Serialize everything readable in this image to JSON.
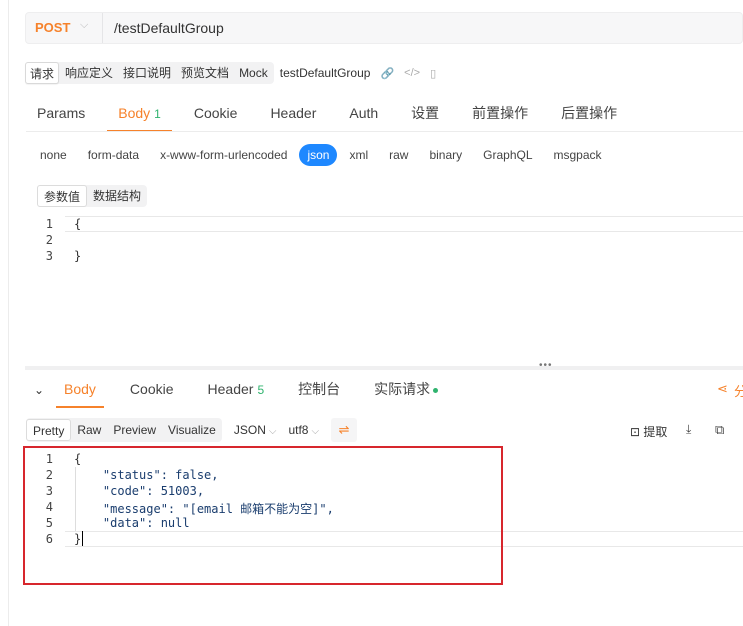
{
  "request": {
    "method": "POST",
    "url": "/testDefaultGroup"
  },
  "subtabs": {
    "items": [
      "请求",
      "响应定义",
      "接口说明",
      "预览文档",
      "Mock"
    ],
    "active": "请求",
    "doc_name": "testDefaultGroup"
  },
  "request_tabs": [
    {
      "label": "Params"
    },
    {
      "label": "Body",
      "count": "1"
    },
    {
      "label": "Cookie"
    },
    {
      "label": "Header"
    },
    {
      "label": "Auth"
    },
    {
      "label": "设置"
    },
    {
      "label": "前置操作"
    },
    {
      "label": "后置操作"
    }
  ],
  "body_types": [
    "none",
    "form-data",
    "x-www-form-urlencoded",
    "json",
    "xml",
    "raw",
    "binary",
    "GraphQL",
    "msgpack"
  ],
  "body_type_active": "json",
  "param_tabs": [
    "参数值",
    "数据结构"
  ],
  "request_editor": {
    "line_numbers": [
      "1",
      "2",
      "3"
    ],
    "lines": [
      "{",
      "",
      "}"
    ]
  },
  "response_tabs": [
    {
      "label": "Body"
    },
    {
      "label": "Cookie"
    },
    {
      "label": "Header",
      "count": "5"
    },
    {
      "label": "控制台"
    },
    {
      "label": "实际请求"
    }
  ],
  "share_label": "分",
  "viewer": {
    "modes": [
      "Pretty",
      "Raw",
      "Preview",
      "Visualize"
    ],
    "format": "JSON",
    "encoding": "utf8",
    "extract_label": "提取"
  },
  "response_editor": {
    "line_numbers": [
      "1",
      "2",
      "3",
      "4",
      "5",
      "6"
    ],
    "lines": [
      "{",
      "    \"status\": false,",
      "    \"code\": 51003,",
      "    \"message\": \"[email 邮箱不能为空]\",",
      "    \"data\": null",
      "}"
    ]
  },
  "colors": {
    "accent": "#f6822b",
    "active_type": "#1e88ff",
    "count_green": "#2fb36e",
    "highlight": "#d7262d"
  }
}
